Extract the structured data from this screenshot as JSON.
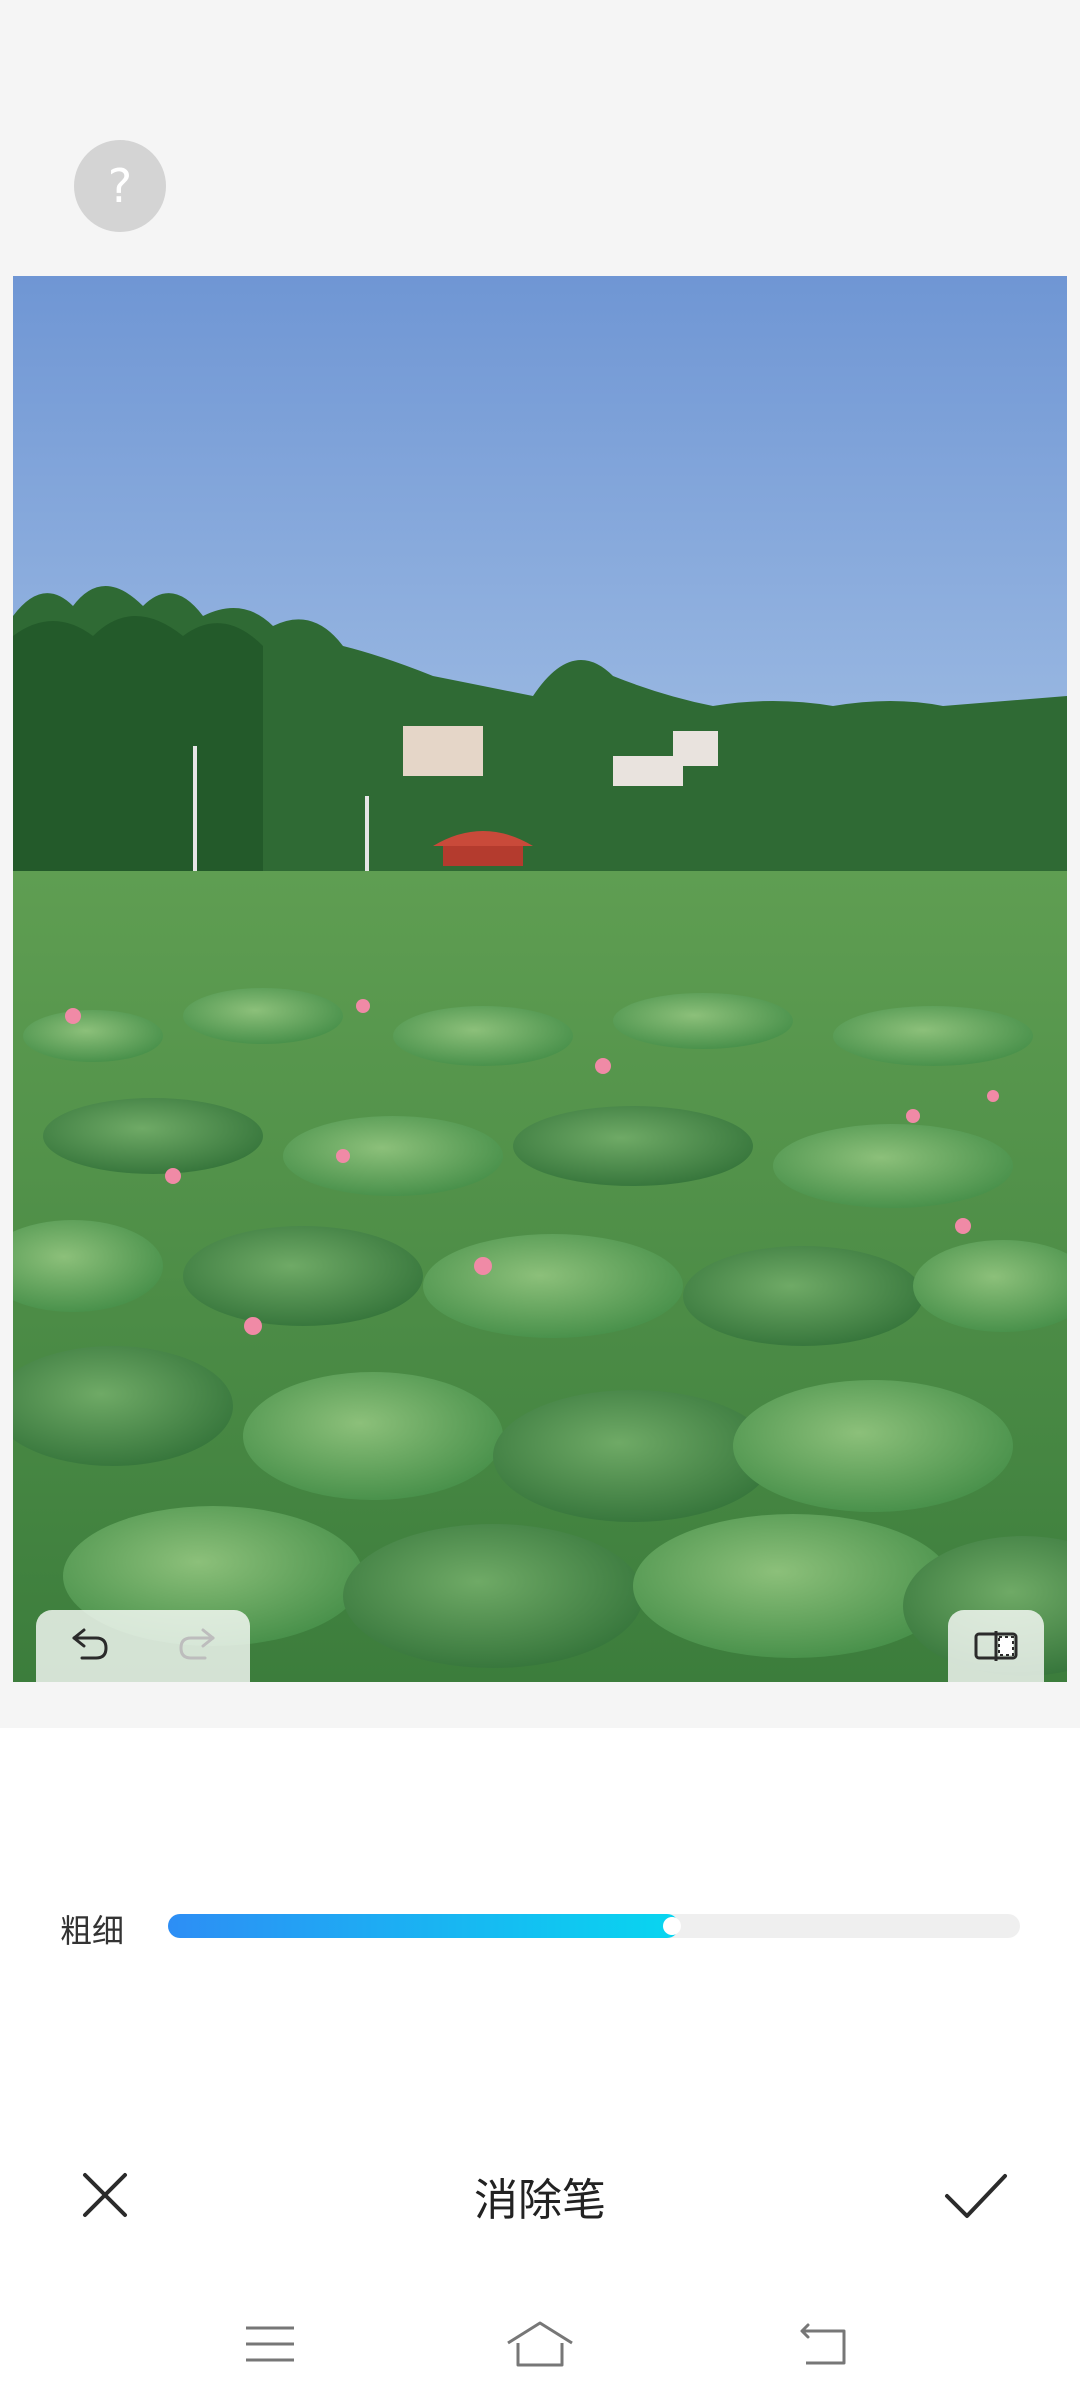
{
  "help": {
    "label": "?"
  },
  "photo": {
    "colors": {
      "sky": "#7fa5d8",
      "leaf": "#4c9a4a",
      "flower": "#f08aa6"
    }
  },
  "brush": {
    "label": "粗细",
    "level_percent": 60
  },
  "action_bar": {
    "title": "消除笔"
  },
  "colors": {
    "accent_start": "#2d8ef5",
    "accent_end": "#08d6f0"
  }
}
